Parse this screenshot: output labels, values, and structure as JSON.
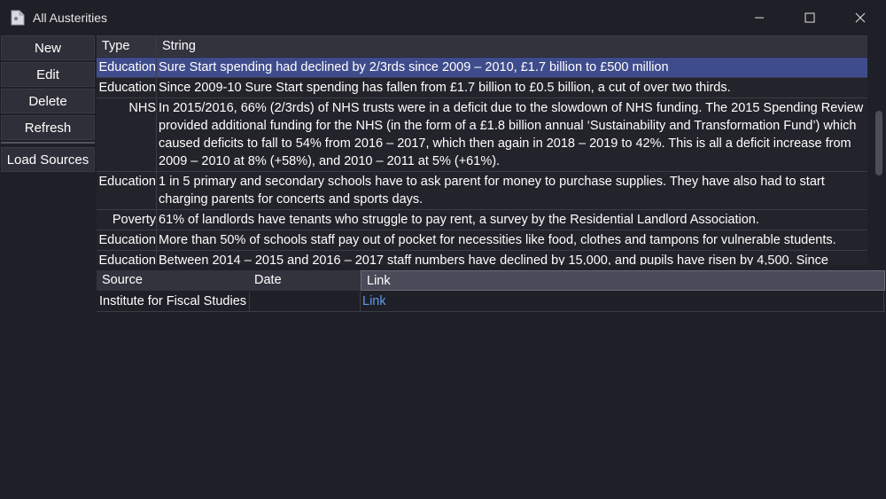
{
  "window": {
    "title": "All Austerities",
    "app_icon": "app-window-icon",
    "controls": [
      "minimize-icon",
      "maximize-icon",
      "close-icon"
    ]
  },
  "sidebar": {
    "buttons": [
      {
        "label": "New"
      },
      {
        "label": "Edit"
      },
      {
        "label": "Delete"
      },
      {
        "label": "Refresh"
      },
      {
        "label": "Load Sources"
      }
    ]
  },
  "austerities_table": {
    "columns": [
      "Type",
      "String"
    ],
    "rows": [
      {
        "type": "Education",
        "string": "Sure Start spending had declined by 2/3rds since 2009 – 2010, £1.7 billion to £500 million",
        "selected": true
      },
      {
        "type": "Education",
        "string": "Since 2009-10 Sure Start spending has fallen from £1.7 billion to £0.5 billion, a cut of over two thirds."
      },
      {
        "type": "NHS",
        "string": "In 2015/2016, 66% (2/3rds) of NHS trusts were in a deficit due to the slowdown of NHS funding. The 2015 Spending Review provided additional funding for the NHS (in the form of a £1.8 billion annual ‘Sustainability and Transformation Fund’) which caused deficits to fall to 54% from 2016 – 2017, which then again in 2018 – 2019 to 42%. This is all a deficit increase from 2009 – 2010 at 8% (+58%), and 2010 – 2011 at 5% (+61%)."
      },
      {
        "type": "Education",
        "string": "1 in 5 primary and secondary schools have to ask parent for money to purchase supplies. They have also had to start charging parents for concerts and sports days."
      },
      {
        "type": "Poverty",
        "string": "61% of landlords have tenants who struggle to pay rent, a survey by the Residential Landlord Association."
      },
      {
        "type": "Education",
        "string": "More than 50% of schools staff pay out of pocket for necessities like food, clothes and tampons for vulnerable students."
      },
      {
        "type": "Education",
        "string": "Between 2014 – 2015 and 2016 – 2017 staff numbers have declined by 15,000, and pupils have risen by 4,500. Since"
      }
    ]
  },
  "sources_table": {
    "columns": [
      "Source",
      "Date",
      "Link"
    ],
    "rows": [
      {
        "source": "Institute for Fiscal Studies",
        "date": "",
        "link": "Link"
      }
    ]
  },
  "colors": {
    "background": "#1f1f27",
    "selected_row": "#3f4c8c",
    "header": "#33333e",
    "link": "#5b9bea"
  }
}
